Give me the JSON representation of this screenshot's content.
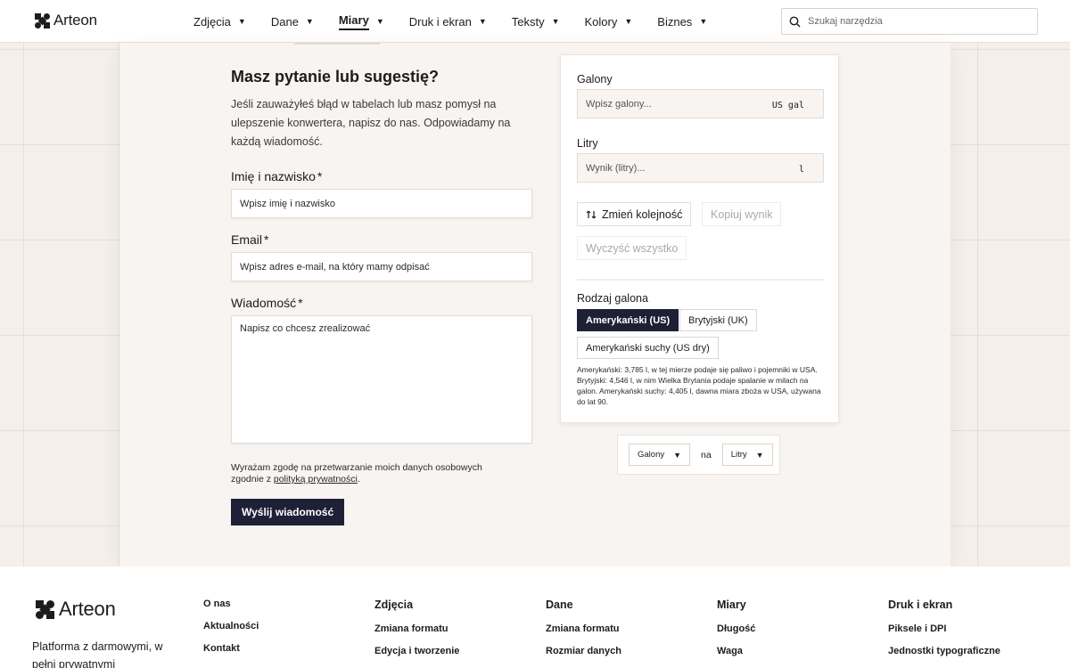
{
  "header": {
    "logo_text": "Arteon",
    "nav": [
      {
        "label": "Zdjęcia",
        "active": false
      },
      {
        "label": "Dane",
        "active": false
      },
      {
        "label": "Miary",
        "active": true
      },
      {
        "label": "Druk i ekran",
        "active": false
      },
      {
        "label": "Teksty",
        "active": false
      },
      {
        "label": "Kolory",
        "active": false
      },
      {
        "label": "Biznes",
        "active": false
      }
    ],
    "caret": "▼",
    "search_placeholder": "Szukaj narzędzia"
  },
  "form": {
    "title": "Masz pytanie lub sugestię?",
    "intro": "Jeśli zauważyłeś błąd w tabelach lub masz pomysł na ulepszenie konwertera, napisz do nas. Odpowiadamy na każdą wiadomość.",
    "name_label": "Imię i nazwisko",
    "name_placeholder": "Wpisz imię i nazwisko",
    "email_label": "Email",
    "email_placeholder": "Wpisz adres e-mail, na który mamy odpisać",
    "message_label": "Wiadomość",
    "message_placeholder": "Napisz co chcesz zrealizować",
    "required_mark": "*",
    "consent_text": "Wyrażam zgodę na przetwarzanie moich danych osobowych zgodnie z ",
    "consent_link": "polityką prywatności",
    "consent_end": ".",
    "submit_label": "Wyślij wiadomość"
  },
  "converter": {
    "from_label": "Galony",
    "from_placeholder": "Wpisz galony...",
    "from_unit": "US gal",
    "to_label": "Litry",
    "to_placeholder": "Wynik (litry)...",
    "to_unit": "l",
    "swap_label": "Zmień kolejność",
    "copy_label": "Kopiuj wynik",
    "clear_label": "Wyczyść wszystko",
    "type_label": "Rodzaj galona",
    "types": [
      {
        "label": "Amerykański (US)",
        "selected": true
      },
      {
        "label": "Brytyjski (UK)",
        "selected": false
      },
      {
        "label": "Amerykański suchy (US dry)",
        "selected": false
      }
    ],
    "note": "Amerykański: 3,785 l, w tej mierze podaje się paliwo i pojemniki w USA. Brytyjski: 4,546 l, w nim Wielka Brytania podaje spalanie w milach na galon. Amerykański suchy: 4,405 l, dawna miara zboża w USA, używana do lat 90."
  },
  "unit_bar": {
    "from": "Galony",
    "connector": "na",
    "to": "Litry"
  },
  "footer": {
    "logo_text": "Arteon",
    "tagline": "Platforma z darmowymi, w pełni prywatnymi",
    "col_about": {
      "links": [
        "O nas",
        "Aktualności",
        "Kontakt"
      ]
    },
    "col_zdjecia": {
      "head": "Zdjęcia",
      "links": [
        "Zmiana formatu",
        "Edycja i tworzenie"
      ]
    },
    "col_dane": {
      "head": "Dane",
      "links": [
        "Zmiana formatu",
        "Rozmiar danych"
      ]
    },
    "col_miary": {
      "head": "Miary",
      "links": [
        "Długość",
        "Waga"
      ]
    },
    "col_druk": {
      "head": "Druk i ekran",
      "links": [
        "Piksele i DPI",
        "Jednostki typograficzne"
      ]
    }
  },
  "colors": {
    "accent_dark": "#1e2035",
    "background": "#f4efeb"
  }
}
